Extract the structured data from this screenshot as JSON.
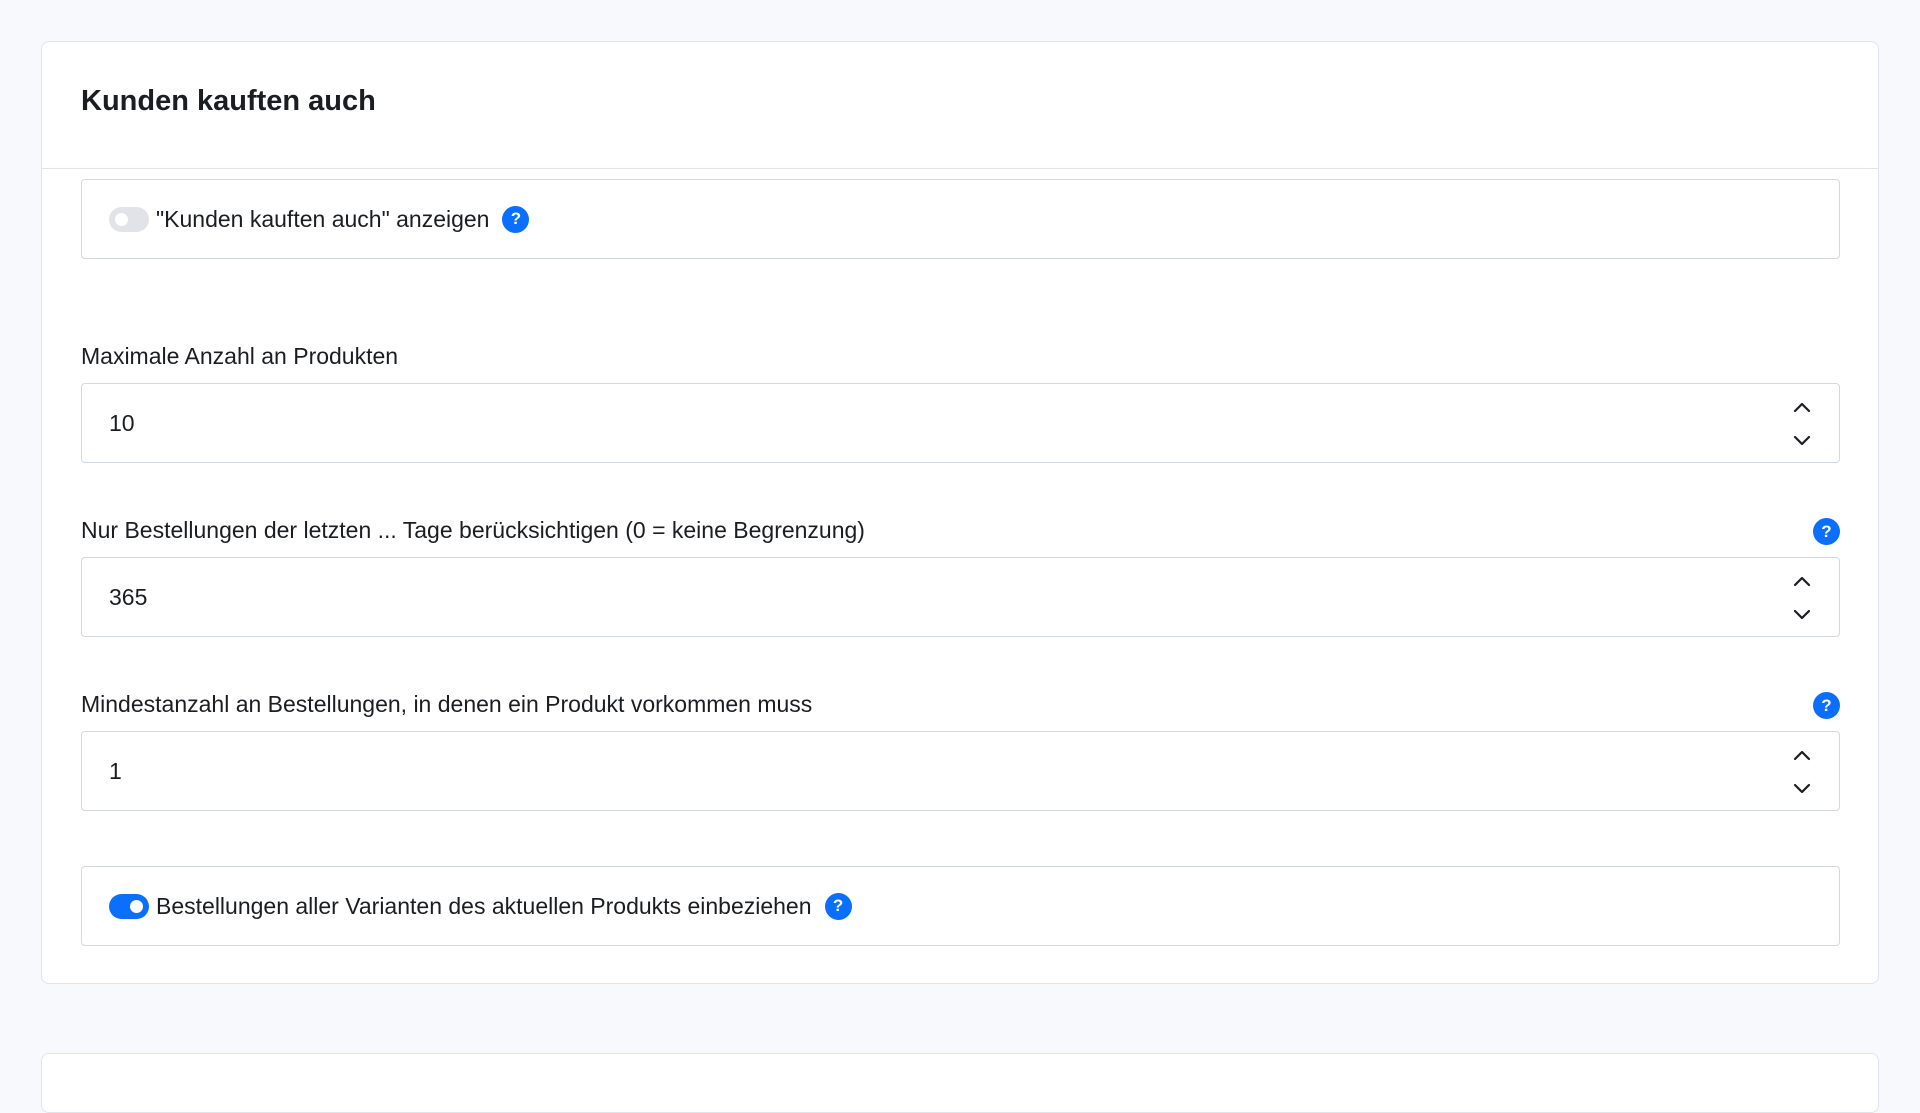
{
  "card": {
    "title": "Kunden kauften auch"
  },
  "show_toggle": {
    "label": "\"Kunden kauften auch\" anzeigen",
    "checked": false
  },
  "max_products": {
    "label": "Maximale Anzahl an Produkten",
    "value": "10"
  },
  "days_limit": {
    "label": "Nur Bestellungen der letzten ... Tage berücksichtigen (0 = keine Begrenzung)",
    "value": "365"
  },
  "min_orders": {
    "label": "Mindestanzahl an Bestellungen, in denen ein Produkt vorkommen muss",
    "value": "1"
  },
  "variants_toggle": {
    "label": "Bestellungen aller Varianten des aktuellen Produkts einbeziehen",
    "checked": true
  },
  "help_symbol": "?",
  "icons": {
    "help": "question-circle-icon",
    "step_up": "chevron-up-icon",
    "step_down": "chevron-down-icon"
  },
  "colors": {
    "accent": "#0b6ffd",
    "toggle_off": "#e1e3e8",
    "border": "#d4d8e1",
    "background": "#f8f9fc"
  }
}
